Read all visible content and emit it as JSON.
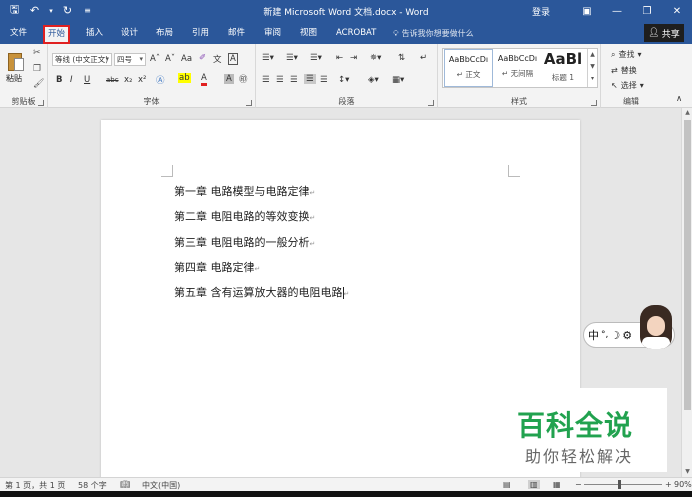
{
  "titlebar": {
    "doc_title": "新建 Microsoft Word 文档.docx  -  Word",
    "login": "登录",
    "quick_access": {
      "save_icon": "save-icon",
      "undo_icon": "undo-icon",
      "redo_icon": "redo-icon",
      "customize_icon": "customize-qat-icon"
    }
  },
  "tabs": [
    {
      "label": "文件"
    },
    {
      "label": "开始"
    },
    {
      "label": "插入"
    },
    {
      "label": "设计"
    },
    {
      "label": "布局"
    },
    {
      "label": "引用"
    },
    {
      "label": "邮件"
    },
    {
      "label": "审阅"
    },
    {
      "label": "视图"
    },
    {
      "label": "ACROBAT"
    }
  ],
  "active_tab": "开始",
  "tell_me": "告诉我你想要做什么",
  "share": "共享",
  "ribbon": {
    "clipboard": {
      "label": "剪贴板",
      "paste": "粘贴"
    },
    "font": {
      "label": "字体",
      "font_name": "等线 (中文正文)",
      "font_size": "四号",
      "grow": "Aˆ",
      "shrink": "Aˇ",
      "case": "Aa",
      "bold": "B",
      "italic": "I",
      "underline": "U",
      "strike": "abc",
      "subscript": "x₂",
      "superscript": "x²"
    },
    "paragraph": {
      "label": "段落"
    },
    "styles": {
      "label": "样式",
      "items": [
        {
          "sample": "AaBbCcDı",
          "name": "↵ 正文"
        },
        {
          "sample": "AaBbCcDı",
          "name": "↵ 无间隔"
        },
        {
          "sample": "AaBl",
          "name": "标题 1"
        }
      ]
    },
    "editing": {
      "label": "编辑",
      "find": "查找",
      "replace": "替换",
      "select": "选择"
    }
  },
  "document": {
    "lines": [
      "第一章  电路模型与电路定律",
      "第二章  电阻电路的等效变换",
      "第三章  电阻电路的一般分析",
      "第四章  电路定律",
      "第五章  含有运算放大器的电阻电路"
    ],
    "para_mark": "↵"
  },
  "ime": {
    "lang": "中",
    "punct": "°,",
    "mode": "☽"
  },
  "watermark": {
    "title": "百科全说",
    "subtitle": "助你轻松解决"
  },
  "statusbar": {
    "page": "第 1 页，共 1 页",
    "words": "58 个字",
    "language": "中文(中国)",
    "zoom": "90%",
    "zoom_level": 0.45
  }
}
